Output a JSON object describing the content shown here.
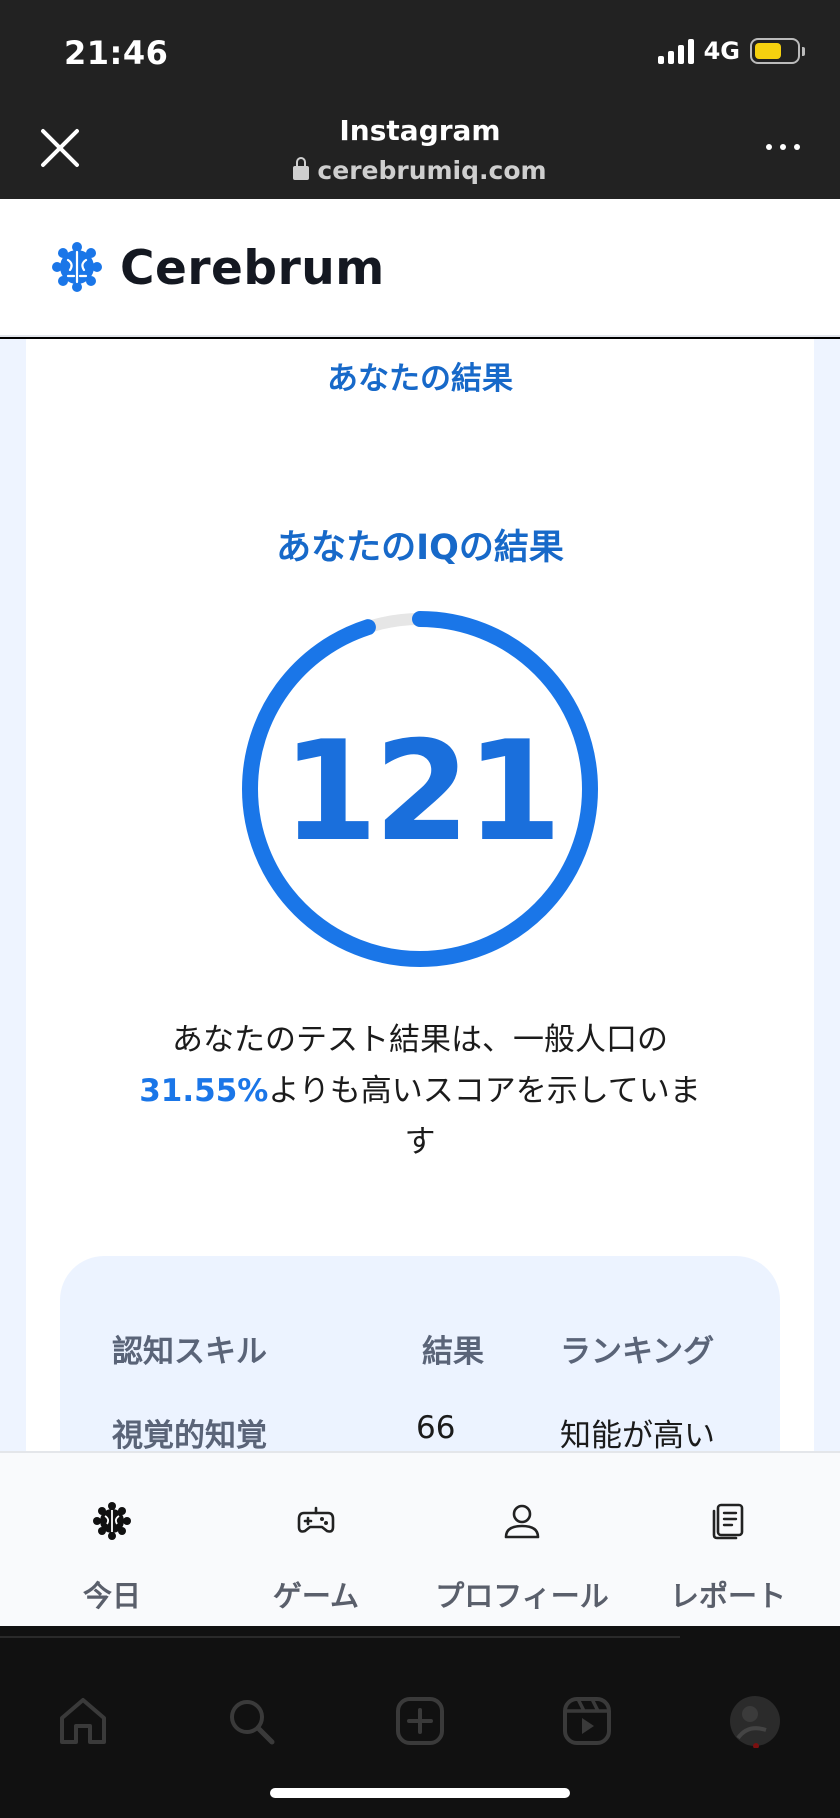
{
  "status_bar": {
    "time": "21:46",
    "network": "4G"
  },
  "browser": {
    "title": "Instagram",
    "url": "cerebrumiq.com"
  },
  "site": {
    "brand": "Cerebrum"
  },
  "result": {
    "section_title": "あなたの結果",
    "iq_title": "あなたのIQの結果",
    "iq_score": "121",
    "gauge_fraction": 0.95,
    "desc_before": "あなたのテスト結果は、一般人口の",
    "desc_percent": "31.55%",
    "desc_after": "よりも高いスコアを示しています"
  },
  "skills_table": {
    "headers": [
      "認知スキル",
      "結果",
      "ランキング"
    ],
    "rows": [
      {
        "skill": "視覚的知覚",
        "score": "66",
        "ranking": "知能が高い"
      }
    ]
  },
  "app_nav": [
    {
      "label": "今日",
      "icon": "brain-icon"
    },
    {
      "label": "ゲーム",
      "icon": "gamepad-icon"
    },
    {
      "label": "プロフィール",
      "icon": "user-icon"
    },
    {
      "label": "レポート",
      "icon": "report-icon"
    }
  ],
  "ig_nav": [
    "home-icon",
    "search-icon",
    "create-icon",
    "reels-icon",
    "profile-avatar"
  ],
  "colors": {
    "accent": "#1a76e8",
    "title_blue": "#1769c9",
    "track": "#e6e6e6"
  }
}
